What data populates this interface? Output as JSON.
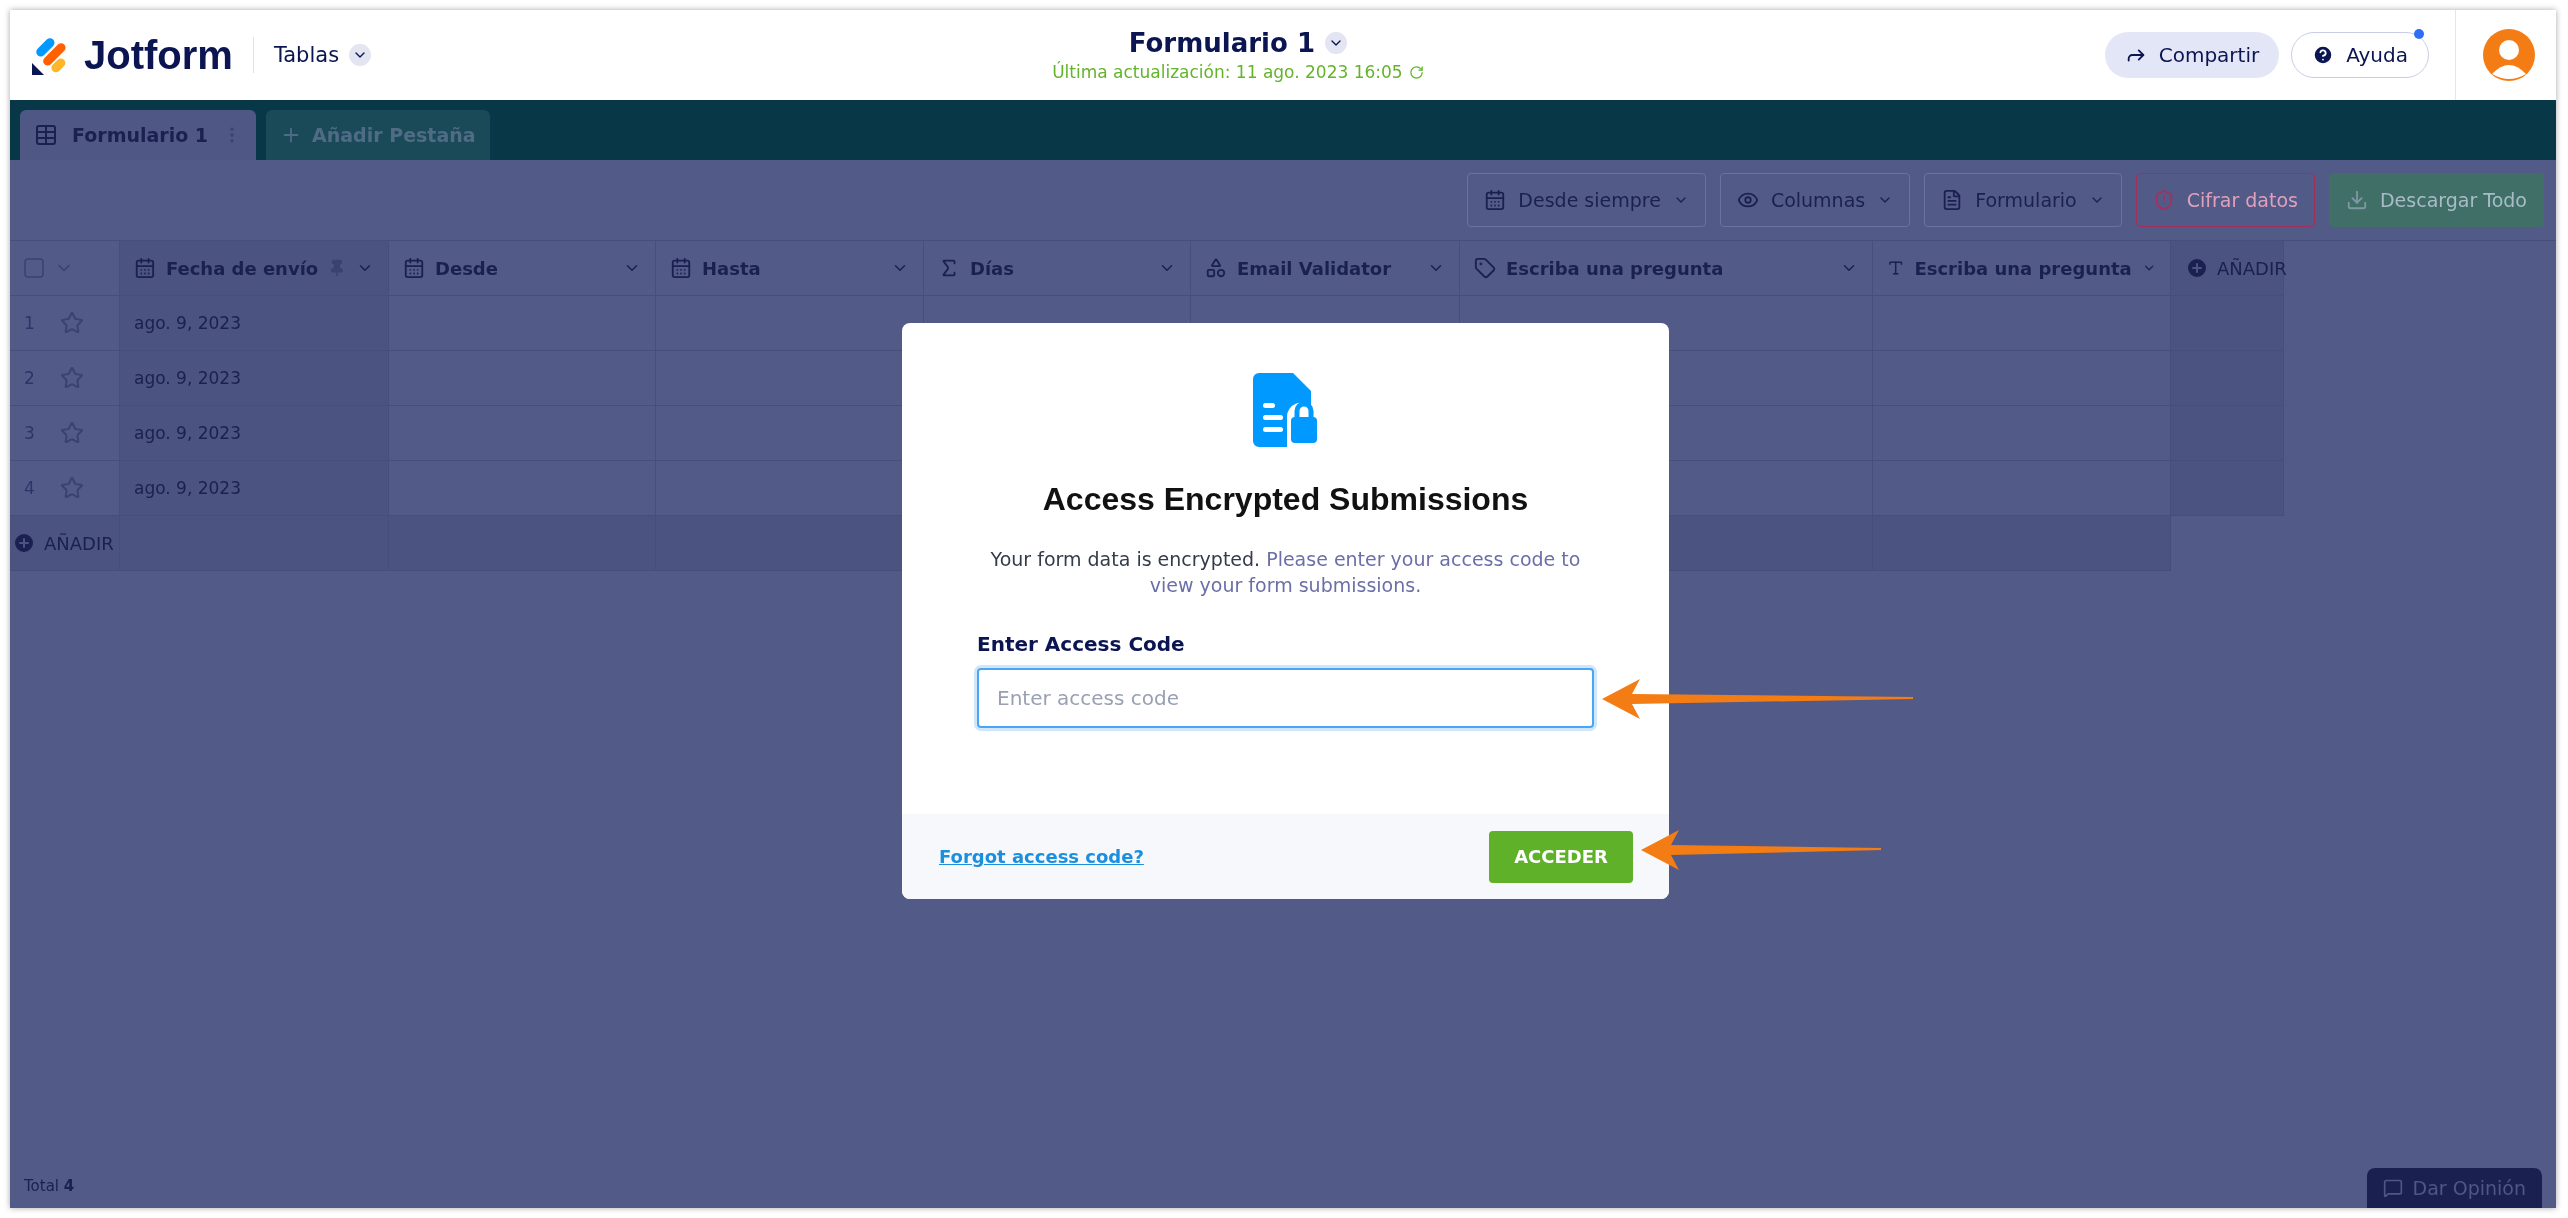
{
  "header": {
    "logo": "Jotform",
    "app_menu": "Tablas",
    "title": "Formulario 1",
    "last_updated": "Última actualización: 11 ago. 2023 16:05",
    "share_button": "Compartir",
    "help_button": {
      "label": "Ayuda",
      "notification": true
    }
  },
  "tabs": [
    {
      "label": "Formulario 1",
      "selected": true
    }
  ],
  "add_tab": "Añadir Pestaña",
  "toolbar": [
    {
      "kind": "date",
      "label": "Desde siempre"
    },
    {
      "kind": "columns",
      "label": "Columnas"
    },
    {
      "kind": "form",
      "label": "Formulario"
    },
    {
      "kind": "encrypt",
      "label": "Cifrar datos"
    },
    {
      "kind": "download",
      "label": "Descargar Todo"
    }
  ],
  "table": {
    "select_all": {
      "checked": false
    },
    "columns": [
      {
        "kind": "date",
        "label": "Fecha de envío",
        "pinned": true
      },
      {
        "kind": "date",
        "label": "Desde",
        "pinned": false
      },
      {
        "kind": "date",
        "label": "Hasta",
        "pinned": false
      },
      {
        "kind": "formula",
        "label": "Días",
        "pinned": false
      },
      {
        "kind": "widget",
        "label": "Email Validator",
        "pinned": false
      },
      {
        "kind": "tag",
        "label": "Escriba una pregunta",
        "pinned": false
      },
      {
        "kind": "text",
        "label": "Escriba una pregunta",
        "pinned": false
      }
    ],
    "add_column": "AÑADIR",
    "rows": [
      {
        "number": "1",
        "starred": false,
        "submitted": "ago. 9, 2023"
      },
      {
        "number": "2",
        "starred": false,
        "submitted": "ago. 9, 2023"
      },
      {
        "number": "3",
        "starred": false,
        "submitted": "ago. 9, 2023"
      },
      {
        "number": "4",
        "starred": false,
        "submitted": "ago. 9, 2023"
      }
    ],
    "add_row": "AÑADIR"
  },
  "footer": {
    "total": "Total **4**",
    "feedback_button": "Dar Opinión"
  },
  "modal": {
    "title": "Access Encrypted Submissions",
    "message": "Your form data is encrypted.",
    "message_hint": "Please enter your access code to view your form submissions.",
    "field_label": "Enter Access Code",
    "placeholder": "Enter access code",
    "forgot_link": "Forgot access code?",
    "submit_button": "ACCEDER"
  }
}
